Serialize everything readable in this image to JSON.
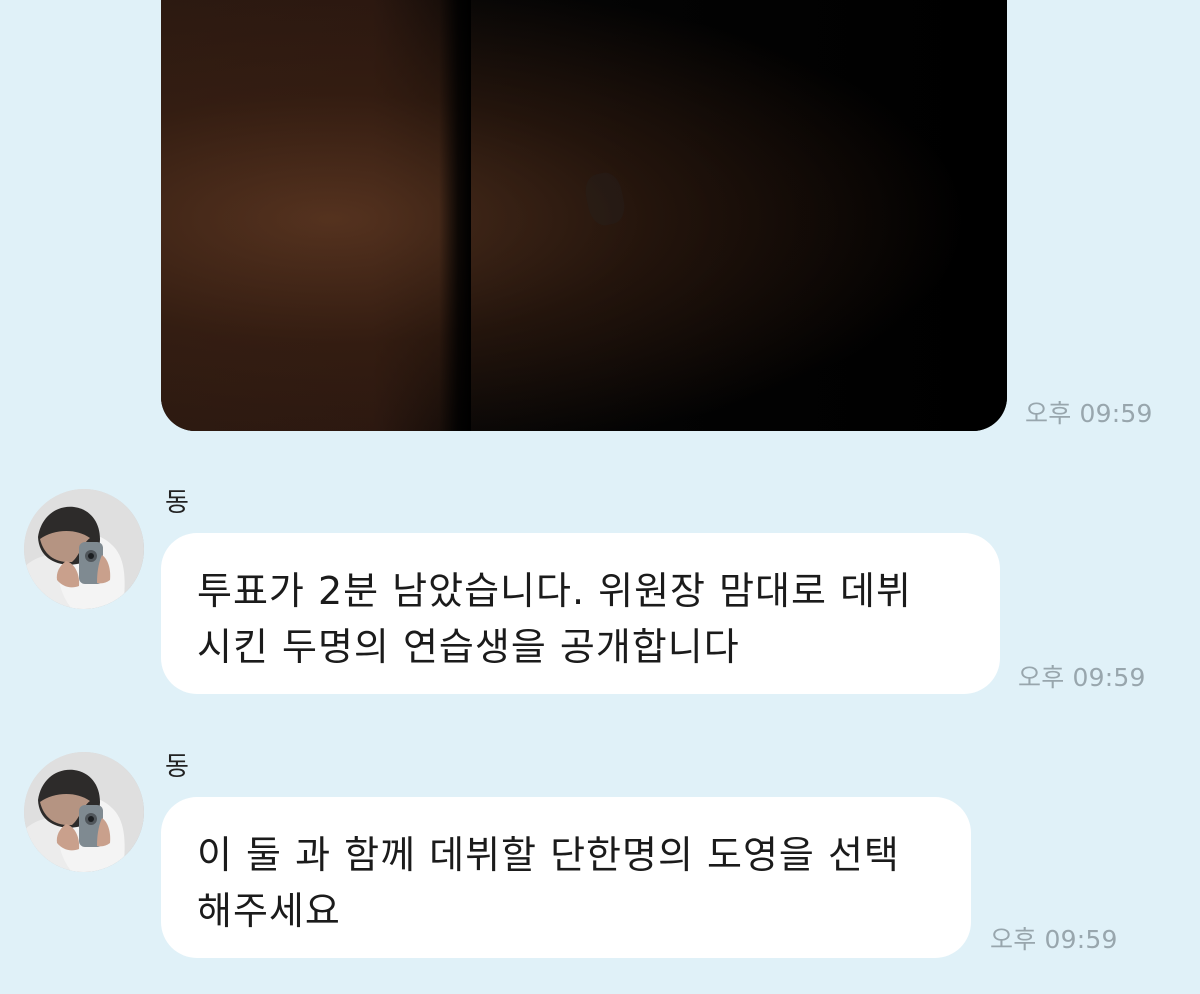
{
  "photo_message": {
    "time": "오후 09:59"
  },
  "messages": [
    {
      "sender": "동",
      "text": "투표가 2분 남았습니다.  위원장 맘대로 데뷔\n시킨 두명의 연습생을 공개합니다",
      "time": "오후 09:59"
    },
    {
      "sender": "동",
      "text": "이 둘 과 함께 데뷔할 단한명의 도영을 선택\n해주세요",
      "time": "오후 09:59"
    }
  ],
  "icons": {
    "avatar": "profile-photo-icon"
  },
  "colors": {
    "background": "#e0f1f8",
    "bubble": "#ffffff",
    "time": "#98a6ad"
  }
}
